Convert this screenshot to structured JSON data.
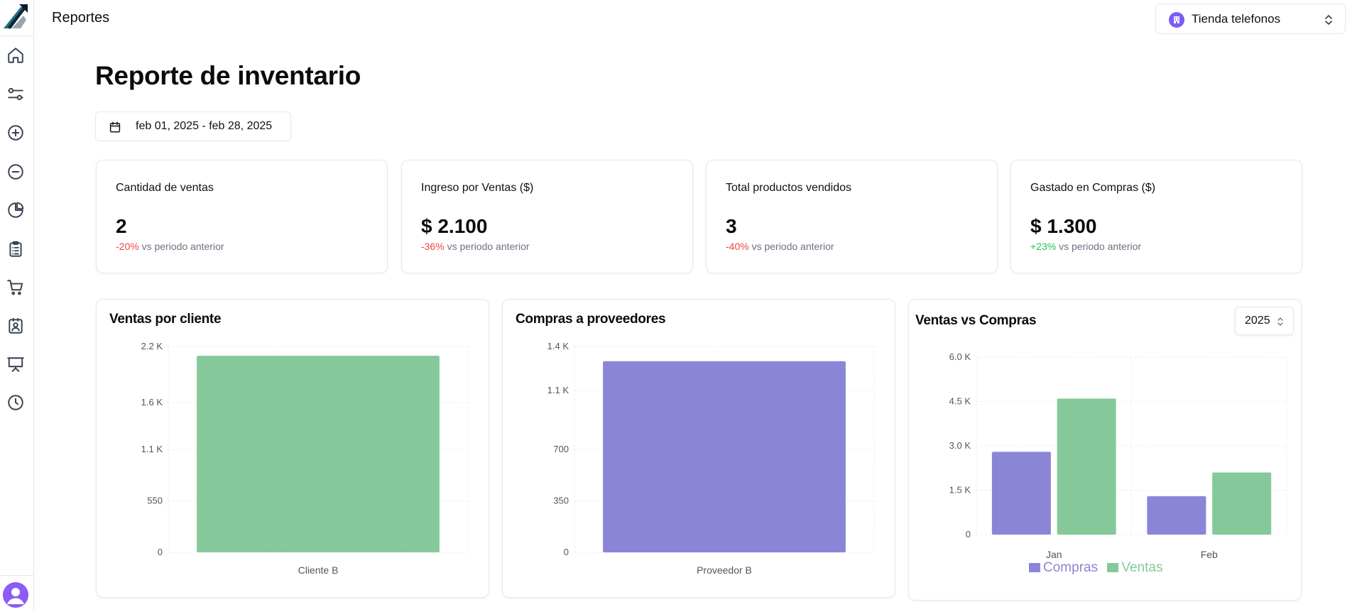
{
  "header": {
    "title": "Reportes",
    "store_selector": {
      "label": "Tienda telefonos",
      "icon": "store-icon"
    }
  },
  "sidebar": {
    "items": [
      {
        "name": "home",
        "icon": "home-icon"
      },
      {
        "name": "settings",
        "icon": "sliders-icon"
      },
      {
        "name": "add",
        "icon": "plus-circle-icon"
      },
      {
        "name": "remove",
        "icon": "minus-circle-icon"
      },
      {
        "name": "reports",
        "icon": "pie-chart-icon"
      },
      {
        "name": "inventory",
        "icon": "clipboard-icon"
      },
      {
        "name": "cart",
        "icon": "cart-icon"
      },
      {
        "name": "contacts",
        "icon": "contact-card-icon"
      },
      {
        "name": "presentation",
        "icon": "presentation-icon"
      },
      {
        "name": "history",
        "icon": "clock-icon"
      }
    ]
  },
  "main": {
    "title": "Reporte de inventario",
    "date_range": "feb 01, 2025 - feb 28, 2025"
  },
  "stats": [
    {
      "label": "Cantidad de ventas",
      "value": "2",
      "delta": "-20%",
      "delta_suffix": " vs periodo anterior",
      "trend": "negative"
    },
    {
      "label": "Ingreso por Ventas ($)",
      "value": "$ 2.100",
      "delta": "-36%",
      "delta_suffix": " vs periodo anterior",
      "trend": "negative"
    },
    {
      "label": "Total productos vendidos",
      "value": "3",
      "delta": "-40%",
      "delta_suffix": " vs periodo anterior",
      "trend": "negative"
    },
    {
      "label": "Gastado en Compras ($)",
      "value": "$ 1.300",
      "delta": "+23%",
      "delta_suffix": " vs periodo anterior",
      "trend": "positive"
    }
  ],
  "colors": {
    "green": "#85c99a",
    "purple": "#8b85d8",
    "negative": "#ef4444",
    "positive": "#22c55e"
  },
  "year_select": {
    "value": "2025"
  },
  "chart_data": [
    {
      "type": "bar",
      "title": "Ventas por cliente",
      "categories": [
        "Cliente B"
      ],
      "values": [
        2100
      ],
      "ylim": [
        0,
        2200
      ],
      "yticks": [
        0,
        550,
        1100,
        1600,
        2200
      ],
      "ytick_labels": [
        "0",
        "550",
        "1.1 K",
        "1.6 K",
        "2.2 K"
      ],
      "color": "#85c99a",
      "grid": true
    },
    {
      "type": "bar",
      "title": "Compras a proveedores",
      "categories": [
        "Proveedor B"
      ],
      "values": [
        1300
      ],
      "ylim": [
        0,
        1400
      ],
      "yticks": [
        0,
        350,
        700,
        1100,
        1400
      ],
      "ytick_labels": [
        "0",
        "350",
        "700",
        "1.1 K",
        "1.4 K"
      ],
      "color": "#8b85d8",
      "grid": true
    },
    {
      "type": "bar",
      "title": "Ventas vs Compras",
      "categories": [
        "Jan",
        "Feb"
      ],
      "series": [
        {
          "name": "Compras",
          "values": [
            2800,
            1300
          ],
          "color": "#8b85d8"
        },
        {
          "name": "Ventas",
          "values": [
            4600,
            2100
          ],
          "color": "#85c99a"
        }
      ],
      "ylim": [
        0,
        6000
      ],
      "yticks": [
        0,
        1500,
        3000,
        4500,
        6000
      ],
      "ytick_labels": [
        "0",
        "1.5 K",
        "3.0 K",
        "4.5 K",
        "6.0 K"
      ],
      "legend": "bottom",
      "grid": true
    }
  ]
}
